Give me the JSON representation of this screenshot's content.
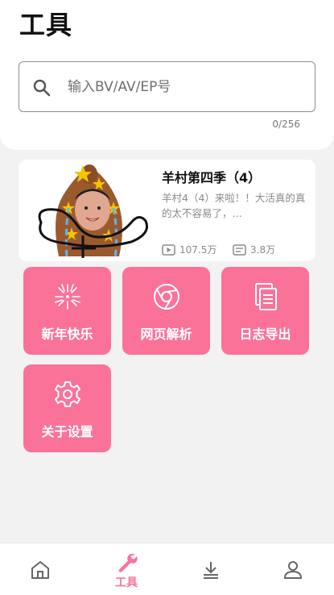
{
  "header": {
    "title": "工具",
    "search": {
      "placeholder": "输入BV/AV/EP号",
      "value": ""
    },
    "counter": "0/256"
  },
  "video": {
    "title": "羊村第四季（4）",
    "description": "羊村4（4）来啦！！大活真的真的太不容易了，…",
    "views": "107.5万",
    "danmaku": "3.8万"
  },
  "tools": [
    {
      "label": "新年快乐",
      "icon": "fireworks-icon"
    },
    {
      "label": "网页解析",
      "icon": "browser-icon"
    },
    {
      "label": "日志导出",
      "icon": "document-icon"
    },
    {
      "label": "关于设置",
      "icon": "gear-icon"
    }
  ],
  "nav": {
    "items": [
      {
        "label": "",
        "icon": "home-icon"
      },
      {
        "label": "工具",
        "icon": "wrench-icon",
        "active": true
      },
      {
        "label": "",
        "icon": "download-icon"
      },
      {
        "label": "",
        "icon": "profile-icon"
      }
    ]
  },
  "colors": {
    "accent": "#fb7299",
    "background": "#f2f2f2",
    "inactive_icon": "#666666"
  }
}
